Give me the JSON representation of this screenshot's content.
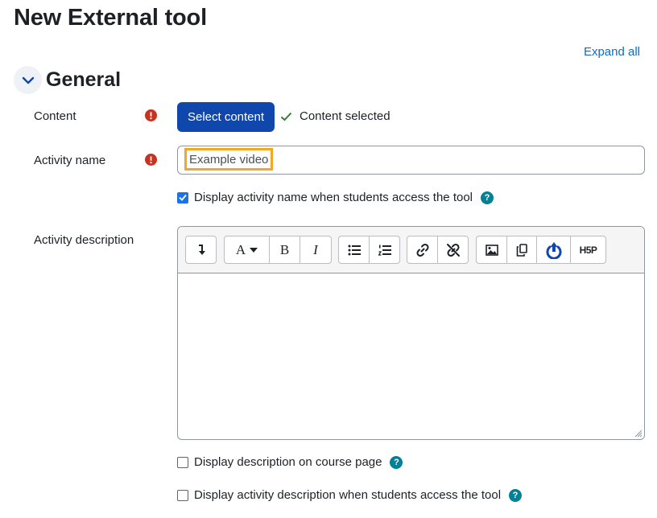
{
  "page": {
    "title": "New External tool"
  },
  "header": {
    "expand_all": "Expand all"
  },
  "section": {
    "title": "General"
  },
  "fields": {
    "content": {
      "label": "Content",
      "button_label": "Select content",
      "status_text": "Content selected"
    },
    "activity_name": {
      "label": "Activity name",
      "value": "Example video",
      "display_on_access": {
        "label": "Display activity name when students access the tool",
        "checked": true
      }
    },
    "activity_description": {
      "label": "Activity description",
      "toolbar_icons": [
        "show-more-icon",
        "font-color-icon",
        "bold-icon",
        "italic-icon",
        "bulleted-list-icon",
        "numbered-list-icon",
        "link-icon",
        "unlink-icon",
        "image-icon",
        "media-icon",
        "record-icon",
        "h5p-icon"
      ],
      "h5p_text": "H5P",
      "font_letter": "A",
      "bold_letter": "B",
      "italic_letter": "I",
      "body": ""
    },
    "show_description": {
      "label": "Display description on course page",
      "checked": false
    },
    "show_description_on_access": {
      "label": "Display activity description when students access the tool",
      "checked": false
    }
  },
  "colors": {
    "primary_button": "#0f47ad",
    "required": "#ca3120",
    "help": "#008196",
    "link": "#0f6cbf",
    "success": "#357a32",
    "highlight": "#f5a623"
  }
}
